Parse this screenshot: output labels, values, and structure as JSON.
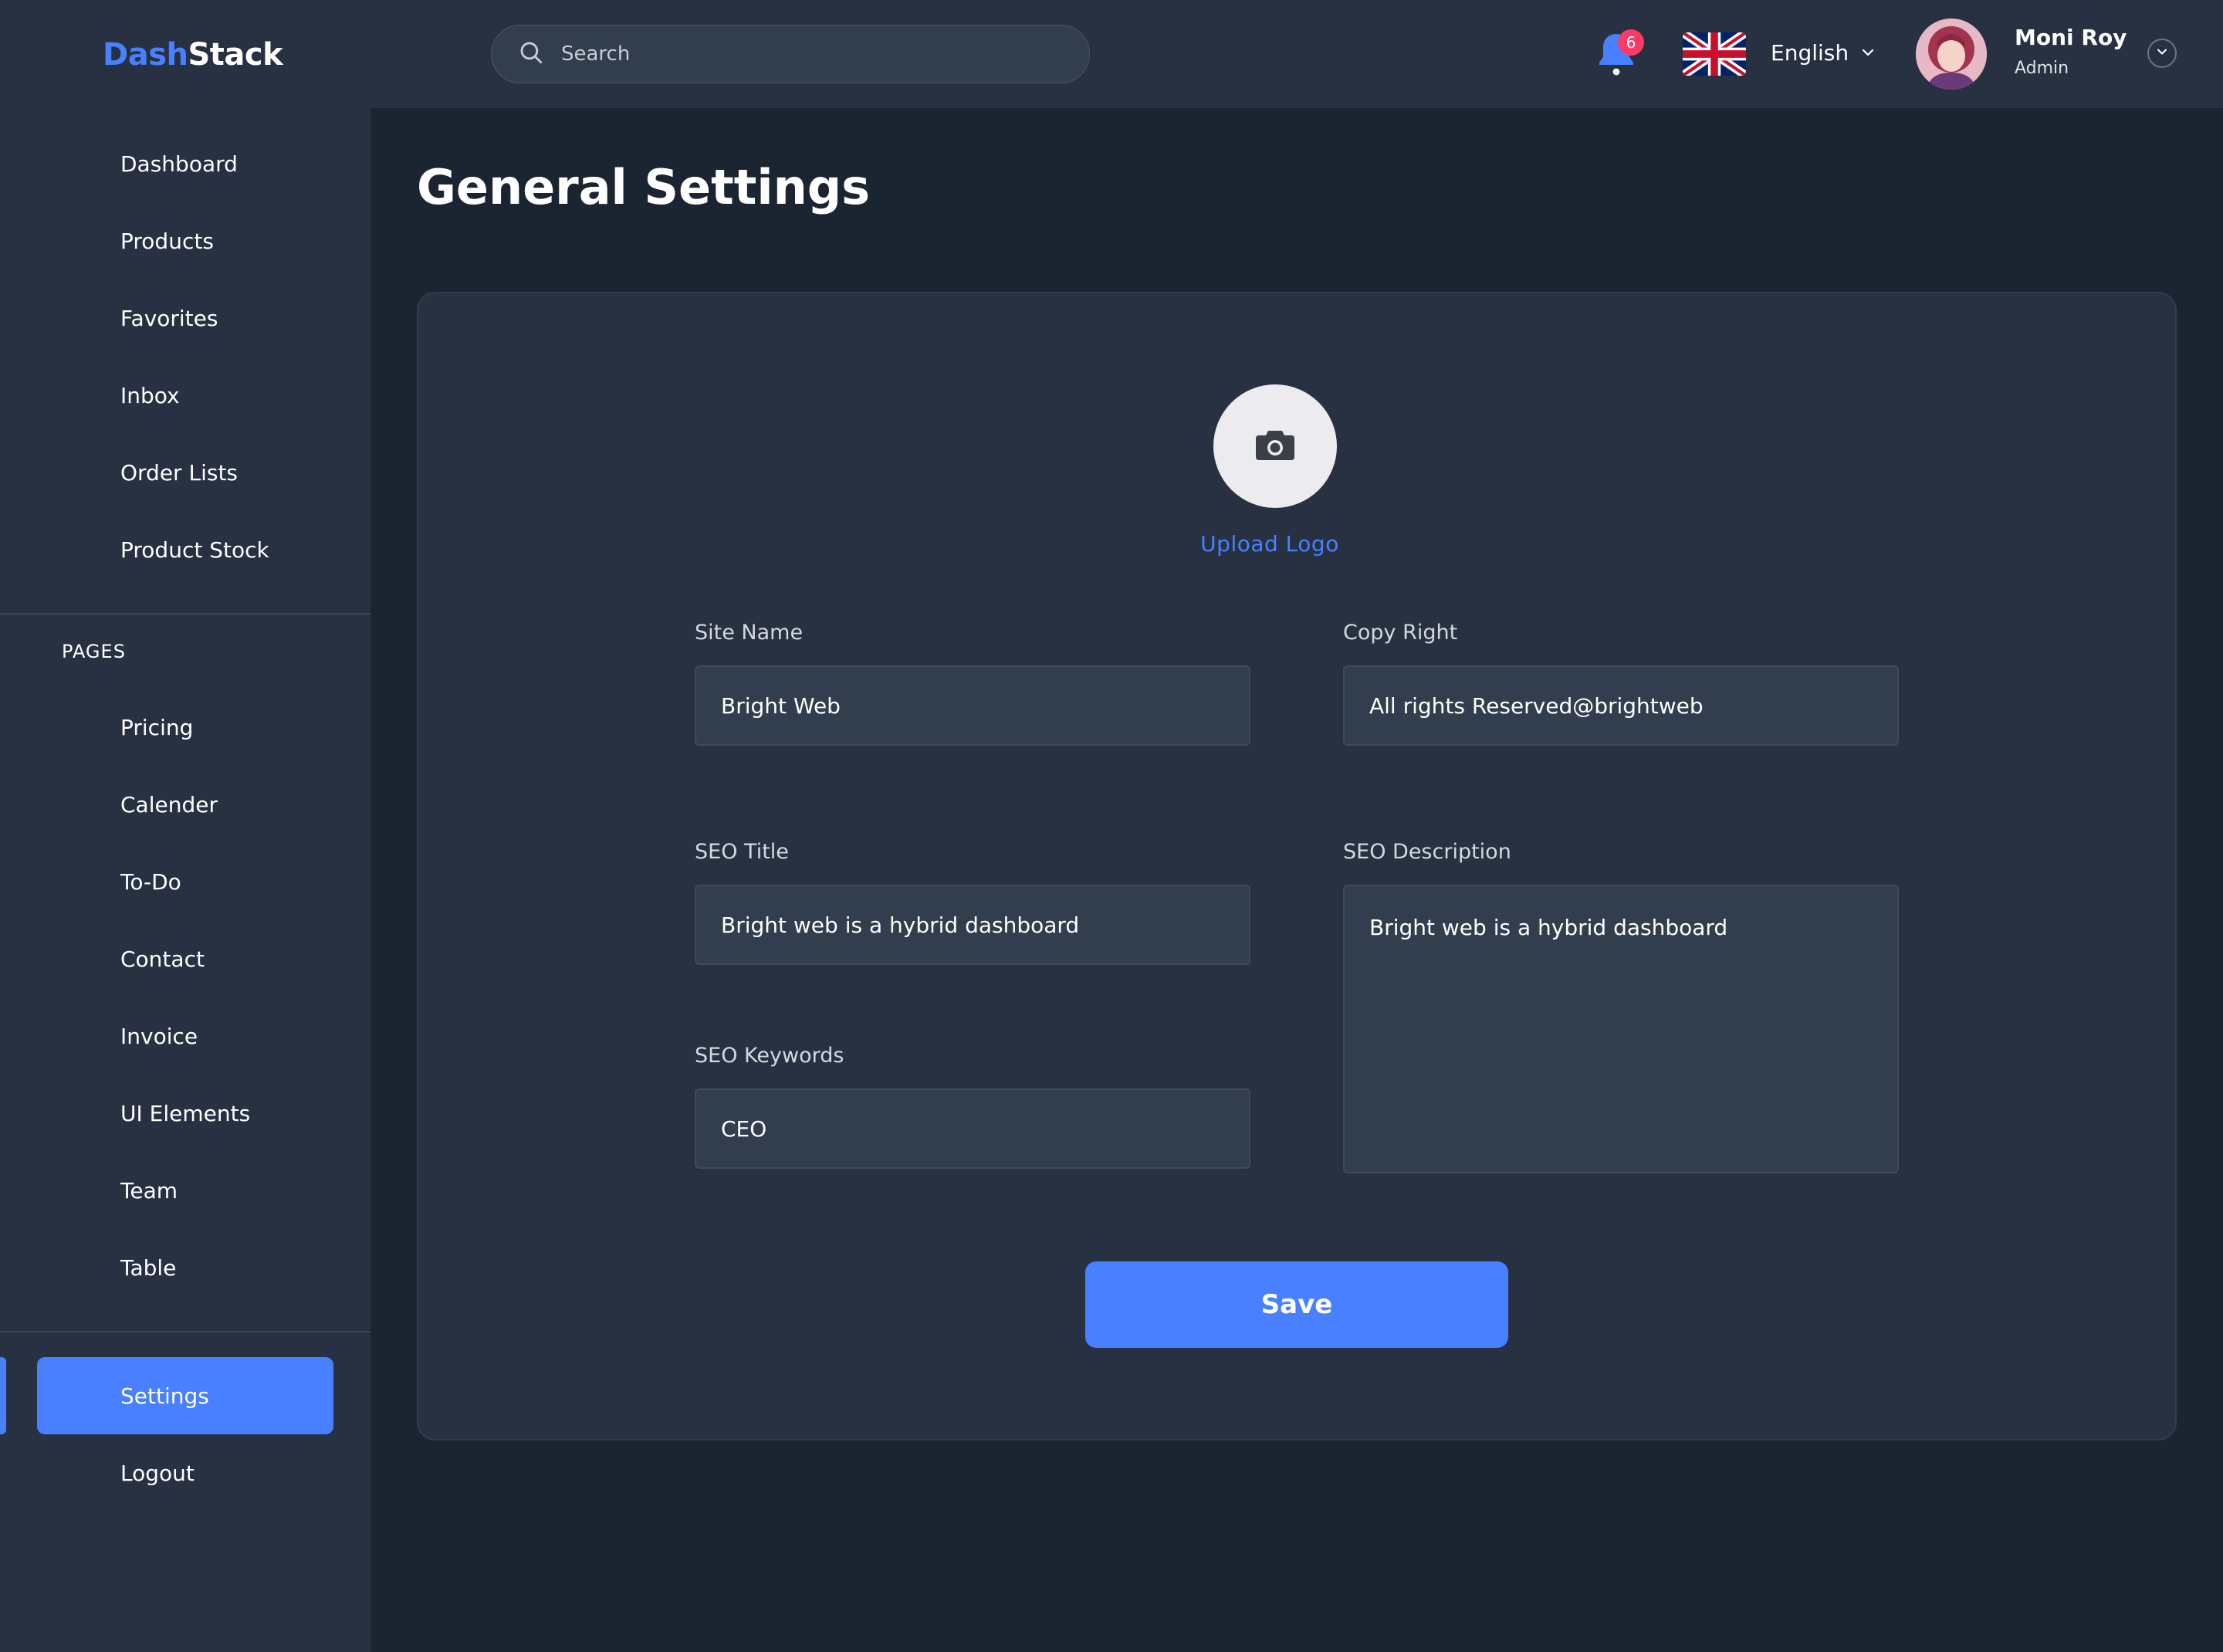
{
  "app": {
    "logo_part1": "Dash",
    "logo_part2": "Stack"
  },
  "sidebar": {
    "items": [
      {
        "label": "Dashboard"
      },
      {
        "label": "Products"
      },
      {
        "label": "Favorites"
      },
      {
        "label": "Inbox"
      },
      {
        "label": "Order Lists"
      },
      {
        "label": "Product Stock"
      }
    ],
    "section_label": "PAGES",
    "pages": [
      {
        "label": "Pricing"
      },
      {
        "label": "Calender"
      },
      {
        "label": "To-Do"
      },
      {
        "label": "Contact"
      },
      {
        "label": "Invoice"
      },
      {
        "label": "UI Elements"
      },
      {
        "label": "Team"
      },
      {
        "label": "Table"
      }
    ],
    "bottom": [
      {
        "label": "Settings",
        "active": true
      },
      {
        "label": "Logout"
      }
    ]
  },
  "topbar": {
    "search_placeholder": "Search",
    "notification_count": "6",
    "language": "English",
    "user_name": "Moni Roy",
    "user_role": "Admin"
  },
  "page": {
    "title": "General Settings"
  },
  "form": {
    "upload_label": "Upload Logo",
    "site_name_label": "Site Name",
    "site_name_value": "Bright Web",
    "copyright_label": "Copy Right",
    "copyright_value": "All rights Reserved@brightweb",
    "seo_title_label": "SEO Title",
    "seo_title_value": "Bright web is a hybrid dashboard",
    "seo_description_label": "SEO Description",
    "seo_description_value": "Bright web is a hybrid dashboard",
    "seo_keywords_label": "SEO Keywords",
    "seo_keywords_value": "CEO",
    "save_label": "Save"
  },
  "colors": {
    "accent": "#4880ff",
    "badge": "#f93c65",
    "background": "#1b2431",
    "surface": "#273142",
    "input": "#323d4e"
  },
  "icons": [
    "search-icon",
    "bell-icon",
    "uk-flag-icon",
    "chevron-down-icon",
    "camera-icon"
  ]
}
